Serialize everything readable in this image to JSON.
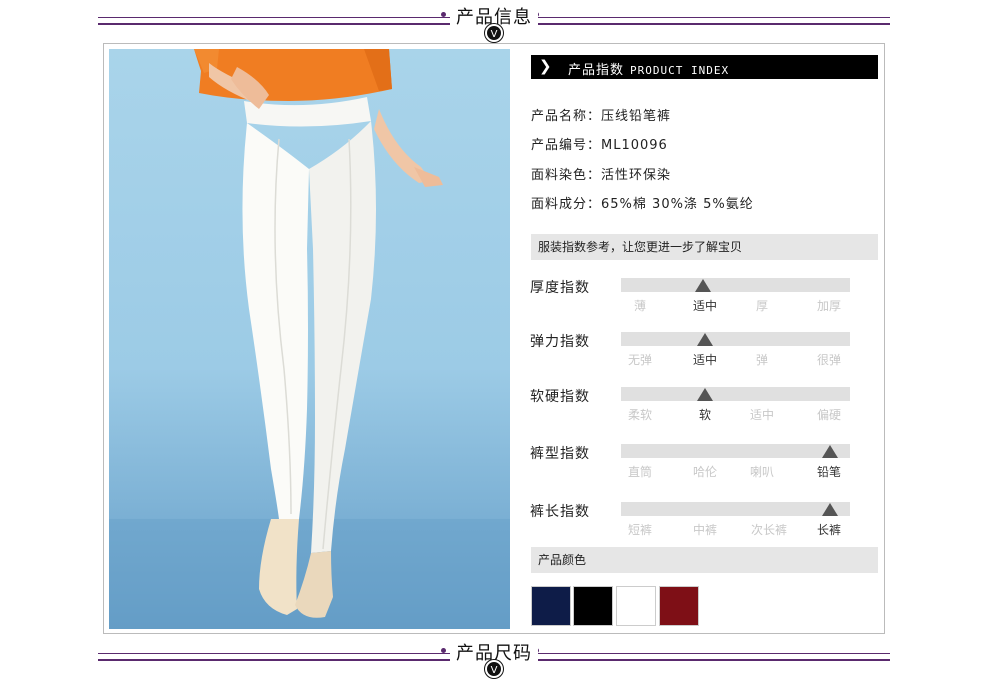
{
  "sections": {
    "top_title": "产品信息",
    "bottom_title": "产品尺码",
    "badge": "V"
  },
  "index_header": {
    "label": "产品指数",
    "label_en": "PRODUCT INDEX"
  },
  "info": [
    {
      "key": "产品名称：",
      "value": "压线铅笔裤"
    },
    {
      "key": "产品编号：",
      "value": "ML10096"
    },
    {
      "key": "面料染色：",
      "value": "活性环保染"
    },
    {
      "key": "面料成分：",
      "value": "65%棉 30%涤 5%氨纶"
    }
  ],
  "guide_text": "服装指数参考，让您更进一步了解宝贝",
  "scales": [
    {
      "label": "厚度指数",
      "options": [
        "薄",
        "适中",
        "厚",
        "加厚"
      ],
      "selected": 1
    },
    {
      "label": "弹力指数",
      "options": [
        "无弹",
        "适中",
        "弹",
        "很弹"
      ],
      "selected": 1
    },
    {
      "label": "软硬指数",
      "options": [
        "柔软",
        "软",
        "适中",
        "偏硬"
      ],
      "selected": 1
    },
    {
      "label": "裤型指数",
      "options": [
        "直筒",
        "哈伦",
        "喇叭",
        "铅笔"
      ],
      "selected": 3
    },
    {
      "label": "裤长指数",
      "options": [
        "短裤",
        "中裤",
        "次长裤",
        "长裤"
      ],
      "selected": 3
    }
  ],
  "colors_label": "产品颜色",
  "swatches": [
    "#0e1c48",
    "#000000",
    "#ffffff",
    "#7e0f16"
  ],
  "theme": {
    "accent": "#5a2a6e"
  }
}
